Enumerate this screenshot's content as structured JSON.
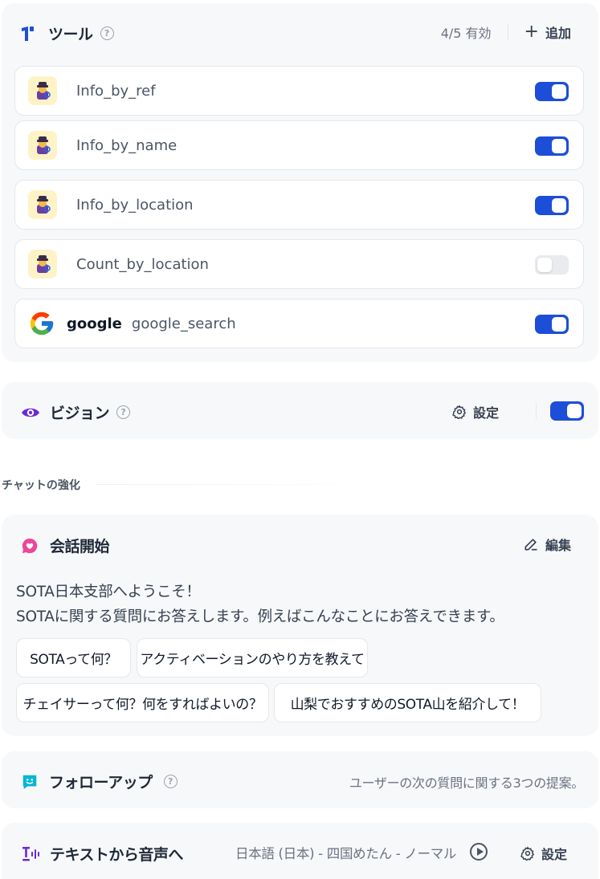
{
  "tools": {
    "title": "ツール",
    "count": "4/5 有効",
    "add_label": "追加",
    "items": [
      {
        "name": "Info_by_ref",
        "icon": "detective-icon",
        "enabled": true
      },
      {
        "name": "Info_by_name",
        "icon": "detective-icon",
        "enabled": true
      },
      {
        "name": "Info_by_location",
        "icon": "detective-icon",
        "enabled": true
      },
      {
        "name": "Count_by_location",
        "icon": "detective-icon",
        "enabled": false
      },
      {
        "provider": "google",
        "name": "google_search",
        "icon": "google-icon",
        "enabled": true
      }
    ]
  },
  "vision": {
    "title": "ビジョン",
    "settings_label": "設定",
    "enabled": true
  },
  "chat_enhance": {
    "label": "チャットの強化"
  },
  "opener": {
    "title": "会話開始",
    "edit_label": "編集",
    "line1": "SOTA日本支部へようこそ！",
    "line2": "SOTAに関する質問にお答えします。例えばこんなことにお答えできます。",
    "questions": [
      "SOTAって何？",
      "アクティベーションのやり方を教えて",
      "チェイサーって何？何をすればよいの？",
      "山梨でおすすめのSOTA山を紹介して！"
    ]
  },
  "follow_up": {
    "title": "フォローアップ",
    "description": "ユーザーの次の質問に関する3つの提案。"
  },
  "tts": {
    "title": "テキストから音声へ",
    "voice": "日本語 (日本) - 四国めたん - ノーマル",
    "settings_label": "設定"
  },
  "colors": {
    "accent": "#1d4ed8",
    "panel_bg": "#f7f8fa",
    "vision_icon": "#6d28d9",
    "opener_icon": "#ec4899",
    "follow_icon": "#06b6d4"
  }
}
